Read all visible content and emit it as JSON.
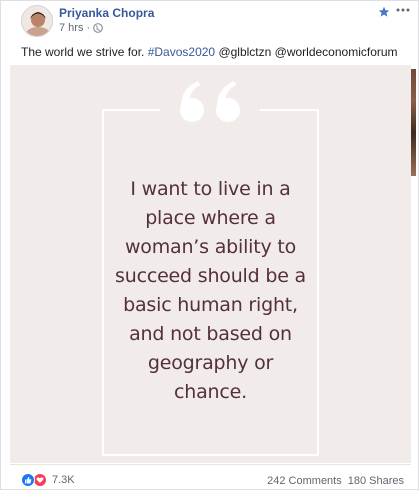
{
  "post": {
    "author": "Priyanka Chopra",
    "time": "7 hrs",
    "text_prefix": "The world we strive for. ",
    "hashtag": "#Davos2020",
    "text_suffix": " @glblctzn @worldeconomicforum"
  },
  "quote": {
    "lines": [
      "I want to live in a",
      "place where a",
      "woman’s ability to",
      "succeed should be a",
      "basic human right,",
      "and not based on",
      "geography or",
      "chance."
    ]
  },
  "footer": {
    "reaction_count": "7.3K",
    "comments": "242 Comments",
    "shares": "180 Shares"
  },
  "colors": {
    "link": "#385898",
    "quote_text": "#54303c",
    "media_bg": "#f1ebe9",
    "like": "#1877f2",
    "love": "#f33e58"
  },
  "icons": [
    "avatar",
    "globe-icon",
    "star-icon",
    "more-icon",
    "quote-marks-icon",
    "like-icon",
    "love-icon"
  ]
}
